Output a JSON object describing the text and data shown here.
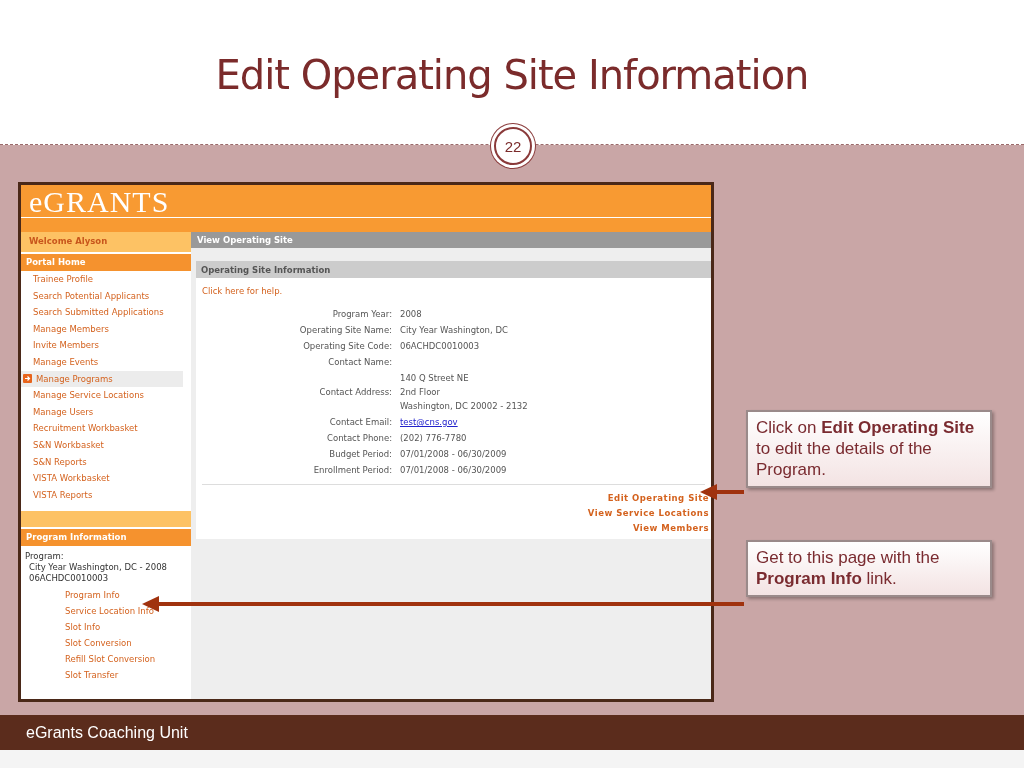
{
  "slide": {
    "title": "Edit Operating Site Information",
    "page_number": "22"
  },
  "app": {
    "logo": "eGRANTS",
    "sidebar": {
      "welcome": "Welcome Alyson",
      "section_title": "Portal Home",
      "items": [
        {
          "label": "Trainee Profile",
          "selected": false
        },
        {
          "label": "Search Potential Applicants",
          "selected": false
        },
        {
          "label": "Search Submitted Applications",
          "selected": false
        },
        {
          "label": "Manage Members",
          "selected": false
        },
        {
          "label": "Invite Members",
          "selected": false
        },
        {
          "label": "Manage Events",
          "selected": false
        },
        {
          "label": "Manage Programs",
          "selected": true
        },
        {
          "label": "Manage Service Locations",
          "selected": false
        },
        {
          "label": "Manage Users",
          "selected": false
        },
        {
          "label": "Recruitment Workbasket",
          "selected": false
        },
        {
          "label": "S&N Workbasket",
          "selected": false
        },
        {
          "label": "S&N Reports",
          "selected": false
        },
        {
          "label": "VISTA Workbasket",
          "selected": false
        },
        {
          "label": "VISTA Reports",
          "selected": false
        }
      ],
      "program_section_title": "Program Information",
      "program_label": "Program:",
      "program_name": "City Year Washington, DC - 2008",
      "program_code": "06ACHDC0010003",
      "program_links": [
        "Program Info",
        "Service Location Info",
        "Slot Info",
        "Slot Conversion",
        "Refill Slot Conversion",
        "Slot Transfer"
      ]
    },
    "main": {
      "page_title": "View Operating Site",
      "panel_title": "Operating Site Information",
      "help_link": "Click here for help.",
      "fields": [
        {
          "label": "Program Year:",
          "kind": "text",
          "values": [
            "2008"
          ]
        },
        {
          "label": "Operating Site Name:",
          "kind": "text",
          "values": [
            "City Year Washington, DC"
          ]
        },
        {
          "label": "Operating Site Code:",
          "kind": "text",
          "values": [
            "06ACHDC0010003"
          ]
        },
        {
          "label": "Contact Name:",
          "kind": "empty"
        },
        {
          "label": "Contact Address:",
          "kind": "text",
          "values": [
            "140 Q Street NE",
            "2nd Floor",
            "Washington, DC 20002 - 2132"
          ]
        },
        {
          "label": "Contact Email:",
          "kind": "link",
          "values": [
            "test@cns.gov"
          ]
        },
        {
          "label": "Contact Phone:",
          "kind": "text",
          "values": [
            "(202) 776-7780"
          ]
        },
        {
          "label": "Budget Period:",
          "kind": "text",
          "values": [
            "07/01/2008 - 06/30/2009"
          ]
        },
        {
          "label": "Enrollment Period:",
          "kind": "text",
          "values": [
            "07/01/2008 - 06/30/2009"
          ]
        }
      ],
      "actions": [
        "Edit Operating Site",
        "View Service Locations",
        "View Members"
      ]
    }
  },
  "callouts": [
    "Click on **Edit Operating Site** to edit the details of the Program.",
    "Get to this page with the **Program Info** link."
  ],
  "footer": "eGrants Coaching Unit"
}
